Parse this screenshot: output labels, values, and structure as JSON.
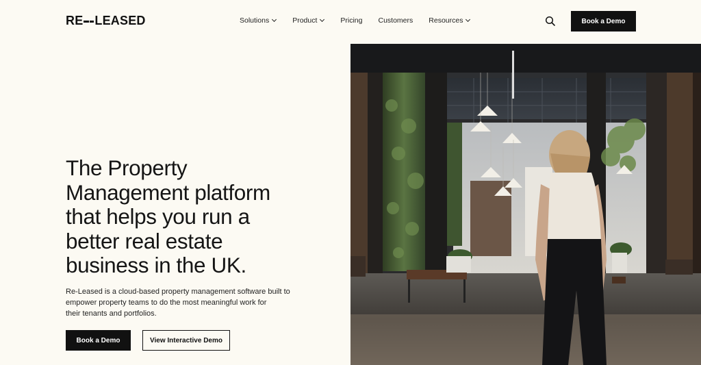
{
  "header": {
    "logo_left": "RE",
    "logo_right": "LEASED",
    "nav": [
      {
        "label": "Solutions",
        "has_dropdown": true
      },
      {
        "label": "Product",
        "has_dropdown": true
      },
      {
        "label": "Pricing",
        "has_dropdown": false
      },
      {
        "label": "Customers",
        "has_dropdown": false
      },
      {
        "label": "Resources",
        "has_dropdown": true
      }
    ],
    "search_icon": "search-icon",
    "cta_label": "Book a Demo"
  },
  "hero": {
    "title_lines": [
      "The Property",
      "Management platform",
      "that helps you run a",
      "better real estate",
      "business in the UK."
    ],
    "subtitle_lines": [
      "Re-Leased is a cloud-based property management software built to",
      "empower property teams to do the most meaningful work for",
      "their tenants and portfolios."
    ],
    "primary_button": "Book a Demo",
    "secondary_button": "View Interactive Demo"
  },
  "colors": {
    "background": "#fcfaf3",
    "text": "#151515",
    "button_dark": "#111111"
  }
}
